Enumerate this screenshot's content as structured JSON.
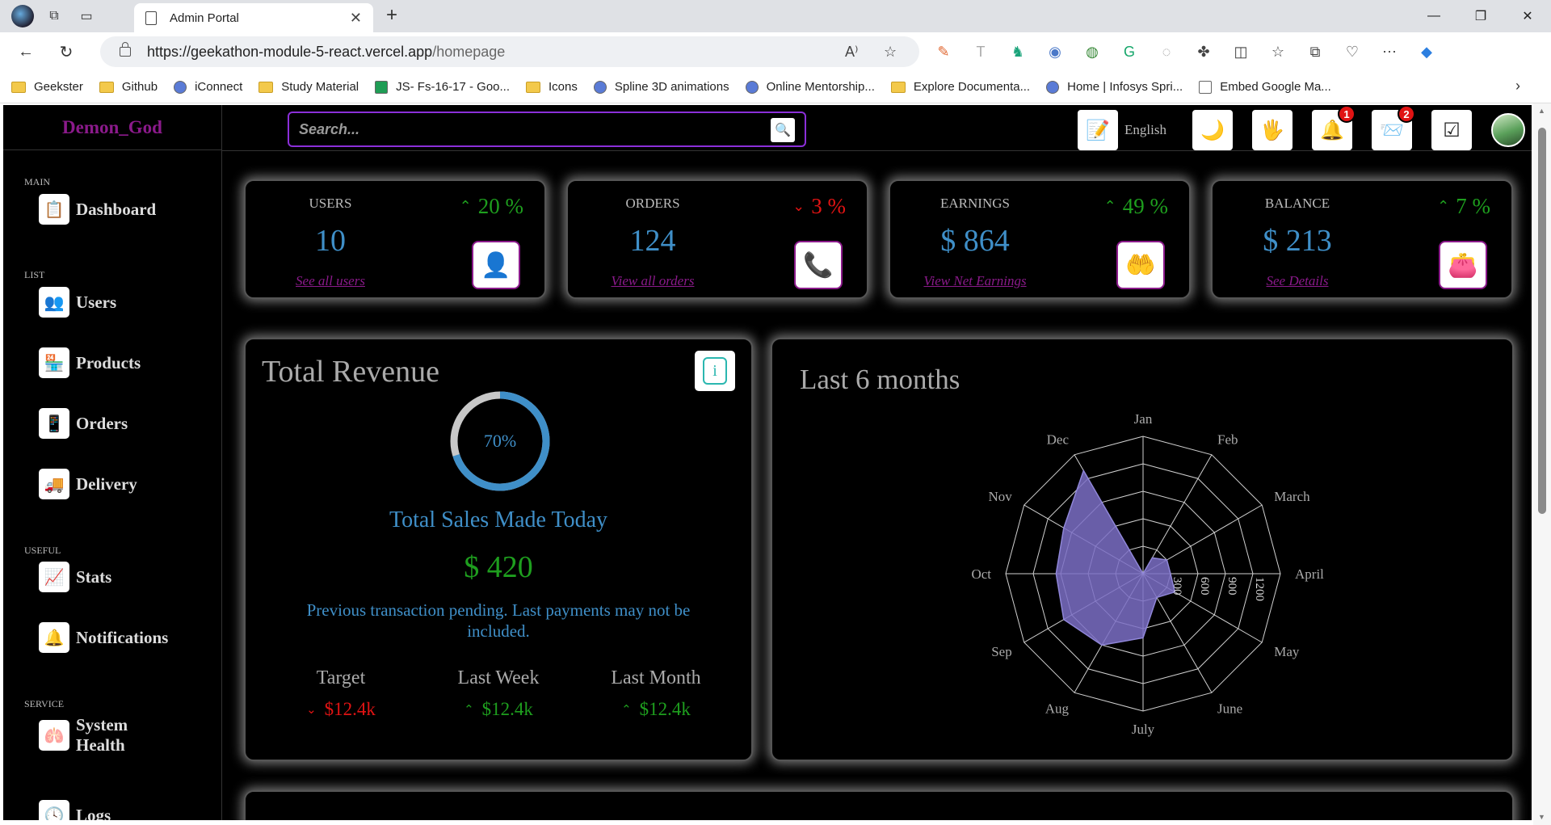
{
  "browser": {
    "tab_title": "Admin Portal",
    "url_host": "https://geekathon-module-5-react.vercel.app",
    "url_path": "/homepage",
    "bookmarks": [
      {
        "label": "Geekster",
        "type": "folder"
      },
      {
        "label": "Github",
        "type": "folder"
      },
      {
        "label": "iConnect",
        "type": "site"
      },
      {
        "label": "Study Material",
        "type": "folder"
      },
      {
        "label": "JS- Fs-16-17 - Goo...",
        "type": "sheet"
      },
      {
        "label": "Icons",
        "type": "folder"
      },
      {
        "label": "Spline 3D animations",
        "type": "site"
      },
      {
        "label": "Online Mentorship...",
        "type": "site"
      },
      {
        "label": "Explore Documenta...",
        "type": "folder"
      },
      {
        "label": "Home | Infosys Spri...",
        "type": "site"
      },
      {
        "label": "Embed Google Ma...",
        "type": "page"
      }
    ]
  },
  "sidebar": {
    "brand": "Demon_God",
    "sections": {
      "main": "MAIN",
      "list": "LIST",
      "useful": "USEFUL",
      "service": "SERVICE"
    },
    "items": {
      "dashboard": "Dashboard",
      "users": "Users",
      "products": "Products",
      "orders": "Orders",
      "delivery": "Delivery",
      "stats": "Stats",
      "notifications": "Notifications",
      "system_health": "System Health",
      "logs": "Logs"
    }
  },
  "topbar": {
    "search_placeholder": "Search...",
    "language": "English",
    "notifications_count": "1",
    "messages_count": "2"
  },
  "widgets": [
    {
      "title": "USERS",
      "value": "10",
      "link": "See all users",
      "percent": "20 %",
      "trend": "up",
      "icon": "user-check-icon"
    },
    {
      "title": "ORDERS",
      "value": "124",
      "link": "View all orders",
      "percent": "3 %",
      "trend": "down",
      "icon": "order-chat-icon"
    },
    {
      "title": "EARNINGS",
      "value": "$ 864",
      "link": "View Net Earnings",
      "percent": "49 %",
      "trend": "up",
      "icon": "money-hand-icon"
    },
    {
      "title": "BALANCE",
      "value": "$ 213",
      "link": "See Details",
      "percent": "7 %",
      "trend": "up",
      "icon": "wallet-icon"
    }
  ],
  "revenue": {
    "title": "Total Revenue",
    "progress_label": "70%",
    "progress": 0.7,
    "subtitle": "Total Sales Made Today",
    "amount": "$ 420",
    "note": "Previous transaction pending. Last payments may not be included.",
    "stats": [
      {
        "label": "Target",
        "value": "$12.4k",
        "trend": "down"
      },
      {
        "label": "Last Week",
        "value": "$12.4k",
        "trend": "up"
      },
      {
        "label": "Last Month",
        "value": "$12.4k",
        "trend": "up"
      }
    ]
  },
  "months_title": "Last 6 months",
  "chart_data": {
    "type": "radar",
    "title": "Last 6 months",
    "categories": [
      "Jan",
      "Feb",
      "March",
      "April",
      "May",
      "June",
      "July",
      "Aug",
      "Sep",
      "Oct",
      "Nov",
      "Dec"
    ],
    "series": [
      {
        "values": [
          0,
          200,
          300,
          300,
          400,
          300,
          700,
          900,
          1000,
          950,
          1000,
          1300
        ]
      }
    ],
    "radial_ticks": [
      "300",
      "600",
      "900",
      "1200"
    ],
    "rmax": 1500,
    "fill_color": "#7b6fc6",
    "grid": true
  },
  "colors": {
    "accent_purple": "#8b1a8b",
    "value_blue": "#3f8fc8",
    "up_green": "#1e9e1e",
    "down_red": "#e01313"
  }
}
